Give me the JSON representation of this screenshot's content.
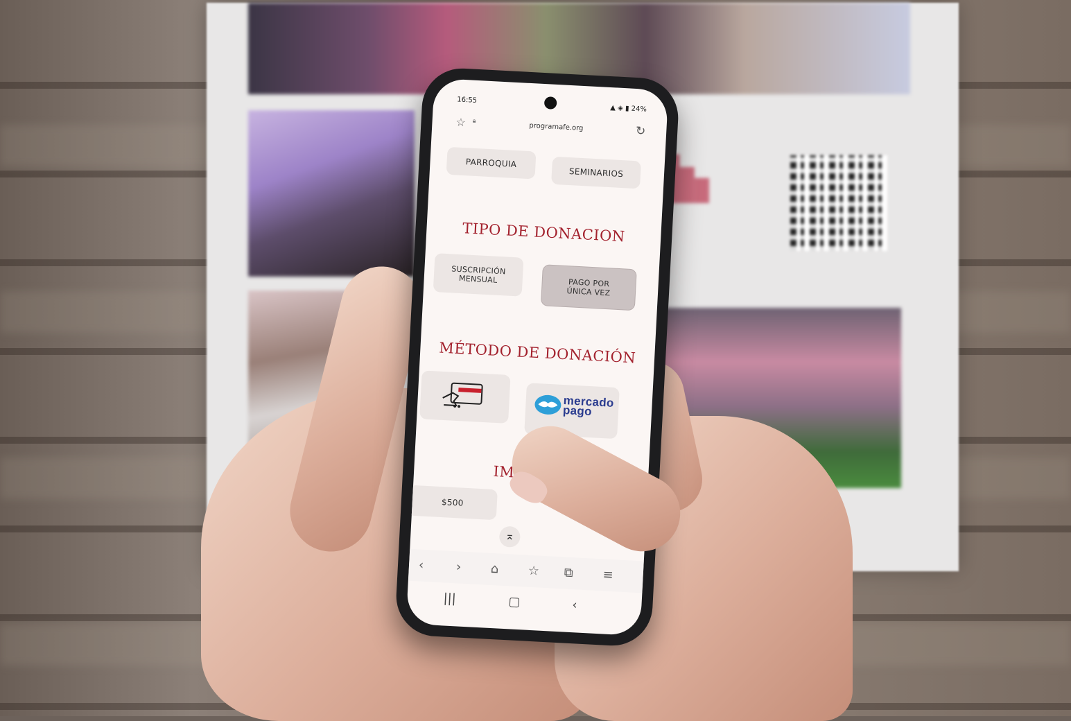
{
  "status_bar": {
    "time": "16:55",
    "battery": "24%"
  },
  "browser": {
    "url": "programafe.org"
  },
  "category_buttons": [
    "PARROQUIA",
    "SEMINARIOS"
  ],
  "donation_type": {
    "heading": "TIPO DE DONACION",
    "options": [
      {
        "label": "SUSCRIPCIÓN MENSUAL",
        "selected": false
      },
      {
        "label": "PAGO POR ÚNICA VEZ",
        "selected": true
      }
    ]
  },
  "donation_method": {
    "heading": "MÉTODO DE DONACIÓN",
    "options": [
      {
        "icon": "credit-card-icon"
      },
      {
        "icon": "mercado-pago-logo",
        "logo_text": "mercado pago"
      }
    ]
  },
  "amount": {
    "heading": "IMPORTE",
    "options": [
      "$500"
    ]
  },
  "colors": {
    "accent": "#a3222e",
    "mercado_pago": "#2b3c8f"
  }
}
